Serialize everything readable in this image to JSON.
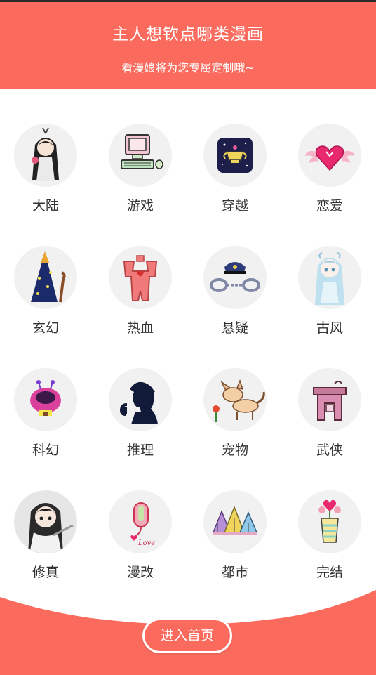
{
  "header": {
    "title": "主人想钦点哪类漫画",
    "subtitle": "看漫娘将为您专属定制哦~"
  },
  "categories": [
    {
      "label": "大陆",
      "icon": "girl-character-icon"
    },
    {
      "label": "游戏",
      "icon": "computer-icon"
    },
    {
      "label": "穿越",
      "icon": "trophy-icon"
    },
    {
      "label": "恋爱",
      "icon": "winged-heart-icon"
    },
    {
      "label": "玄幻",
      "icon": "wizard-hat-icon"
    },
    {
      "label": "热血",
      "icon": "muscle-shirt-icon"
    },
    {
      "label": "悬疑",
      "icon": "police-cap-handcuffs-icon"
    },
    {
      "label": "古风",
      "icon": "ancient-girl-icon"
    },
    {
      "label": "科幻",
      "icon": "ufo-house-icon"
    },
    {
      "label": "推理",
      "icon": "detective-silhouette-icon"
    },
    {
      "label": "宠物",
      "icon": "fox-flower-icon"
    },
    {
      "label": "武侠",
      "icon": "torii-gate-icon"
    },
    {
      "label": "修真",
      "icon": "swordsman-icon"
    },
    {
      "label": "漫改",
      "icon": "mouse-love-icon"
    },
    {
      "label": "都市",
      "icon": "tents-icon"
    },
    {
      "label": "完结",
      "icon": "flower-pot-icon"
    }
  ],
  "footer": {
    "button_label": "进入首页"
  },
  "colors": {
    "accent": "#fa6b5e",
    "circle_bg": "#f1f1f2",
    "text": "#333333"
  }
}
